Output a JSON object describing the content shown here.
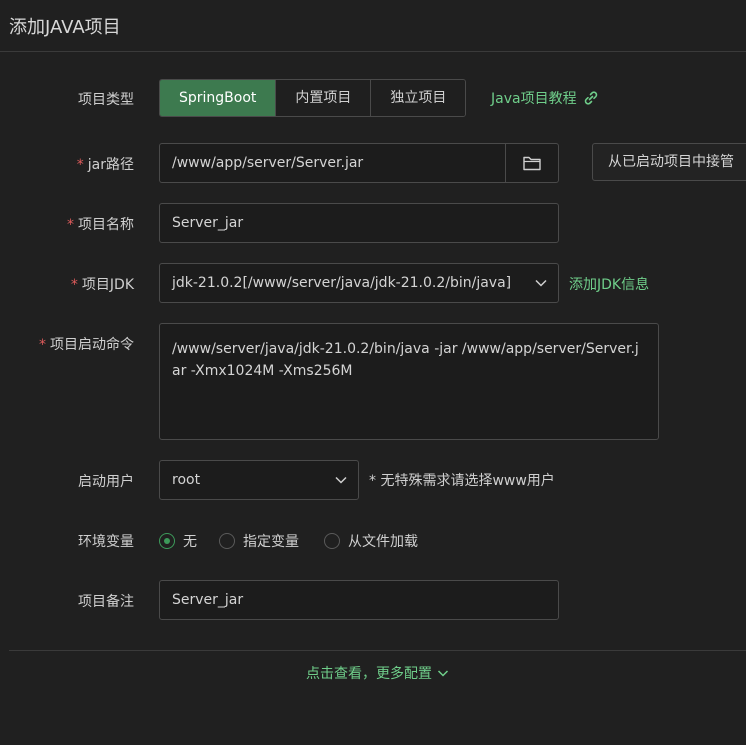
{
  "window": {
    "title": "添加JAVA项目"
  },
  "form": {
    "project_type": {
      "label": "项目类型",
      "options": [
        "SpringBoot",
        "内置项目",
        "独立项目"
      ],
      "selected": "SpringBoot",
      "tutorial_link": "Java项目教程"
    },
    "jar_path": {
      "required": "*",
      "label": "jar路径",
      "value": "/www/app/server/Server.jar",
      "takeover_button": "从已启动项目中接管"
    },
    "project_name": {
      "required": "*",
      "label": "项目名称",
      "value": "Server_jar"
    },
    "project_jdk": {
      "required": "*",
      "label": "项目JDK",
      "value": "jdk-21.0.2[/www/server/java/jdk-21.0.2/bin/java]",
      "add_link": "添加JDK信息"
    },
    "start_command": {
      "required": "*",
      "label": "项目启动命令",
      "value": "/www/server/java/jdk-21.0.2/bin/java -jar /www/app/server/Server.jar -Xmx1024M -Xms256M"
    },
    "start_user": {
      "label": "启动用户",
      "value": "root",
      "hint": "* 无特殊需求请选择www用户"
    },
    "env_vars": {
      "label": "环境变量",
      "options": [
        "无",
        "指定变量",
        "从文件加载"
      ],
      "selected": "无"
    },
    "remark": {
      "label": "项目备注",
      "value": "Server_jar"
    }
  },
  "footer": {
    "more_config": "点击查看，更多配置"
  },
  "colors": {
    "accent": "#3d7a4f",
    "link": "#6fce8a",
    "required": "#e05c5c",
    "background": "#202020"
  }
}
